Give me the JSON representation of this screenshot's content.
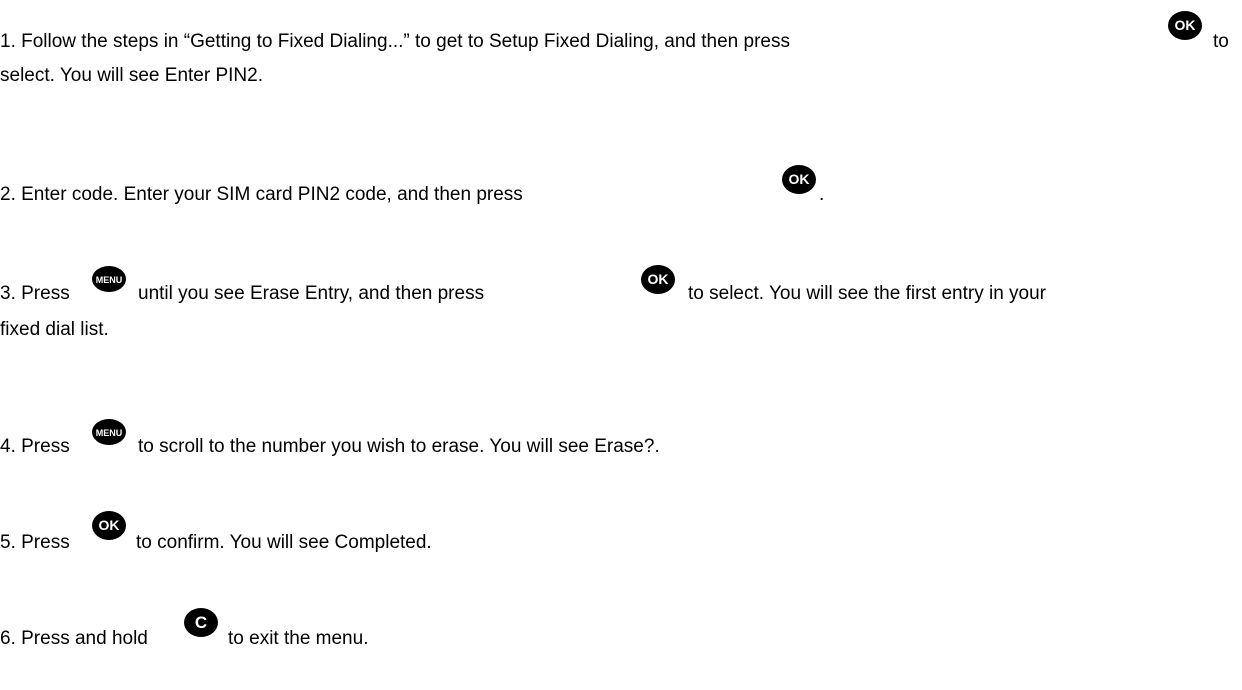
{
  "steps": [
    {
      "line1_a": "1. Follow the steps in “Getting to Fixed Dialing...” to get to Setup Fixed Dialing, and then press",
      "line1_b": "to",
      "line2": "select. You will see Enter PIN2."
    },
    {
      "line1_a": "2. Enter code. Enter your SIM card PIN2 code, and then press",
      "line1_b": "."
    },
    {
      "line1_a": "3. Press",
      "line1_b": "until you see Erase Entry, and then press",
      "line1_c": "to select. You will see the first entry in your",
      "line2": "fixed dial list."
    },
    {
      "line1_a": "4. Press",
      "line1_b": "to scroll to the number you wish to erase. You will see Erase?."
    },
    {
      "line1_a": "5. Press",
      "line1_b": "to confirm. You will see Completed."
    },
    {
      "line1_a": "6. Press and hold",
      "line1_b": "to exit the menu."
    }
  ],
  "keys": {
    "ok": "OK",
    "menu": "MENU",
    "clear": "C"
  },
  "icons": {
    "ok": "ok-key-icon",
    "menu": "menu-key-icon",
    "clear": "c-key-icon"
  }
}
